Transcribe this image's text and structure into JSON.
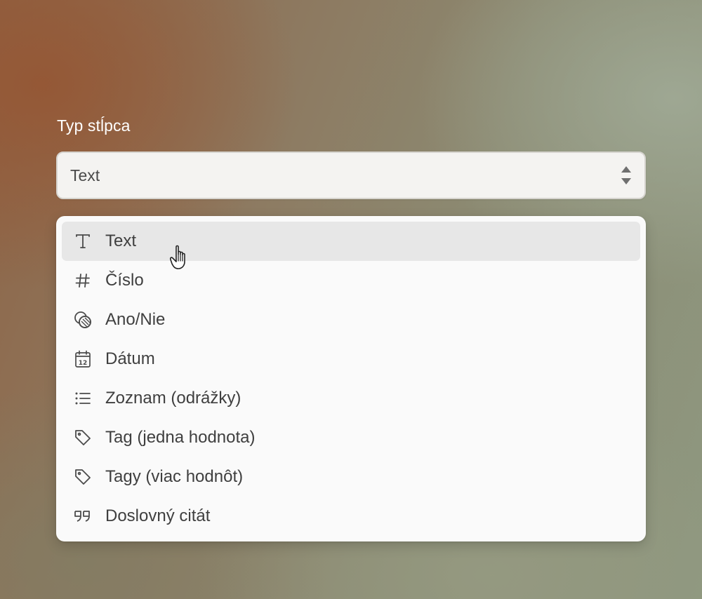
{
  "field": {
    "label": "Typ stĺpca",
    "selected_value": "Text",
    "arrows_icon": "sort-arrows-icon"
  },
  "menu": {
    "highlighted_index": 0,
    "options": [
      {
        "label": "Text",
        "icon": "text-icon"
      },
      {
        "label": "Číslo",
        "icon": "hash-icon"
      },
      {
        "label": "Ano/Nie",
        "icon": "toggle-circles-icon"
      },
      {
        "label": "Dátum",
        "icon": "calendar-icon"
      },
      {
        "label": "Zoznam (odrážky)",
        "icon": "list-icon"
      },
      {
        "label": "Tag (jedna hodnota)",
        "icon": "tag-icon"
      },
      {
        "label": "Tagy (viac hodnôt)",
        "icon": "tag-icon"
      },
      {
        "label": "Doslovný citát",
        "icon": "quote-icon"
      }
    ]
  },
  "cursor": {
    "icon": "hand-pointer-icon"
  },
  "colors": {
    "highlight": "#e7e7e7",
    "menu_bg": "#fafafa",
    "select_bg": "#f4f3f1",
    "text": "#3f3f3f"
  }
}
